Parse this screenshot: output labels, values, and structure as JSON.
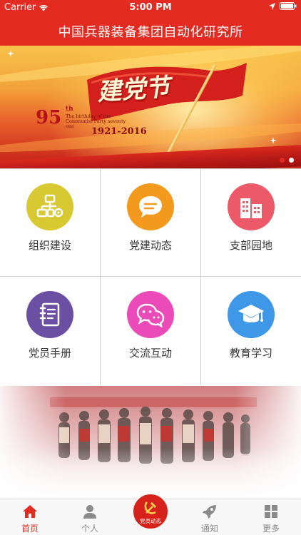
{
  "status_bar": {
    "carrier": "Carrier",
    "time": "5:00 PM"
  },
  "nav": {
    "title": "中国兵器装备集团自动化研究所"
  },
  "banner": {
    "headline": "建党节",
    "anniversary_number": "95",
    "anniversary_suffix": "th",
    "subline": "The birthday of the Communist Party seventy one",
    "years": "1921-2016",
    "active_slide": 1,
    "slide_count": 2
  },
  "grid": {
    "items": [
      {
        "label": "组织建设",
        "icon": "org-structure-icon",
        "color": "#d8c832"
      },
      {
        "label": "党建动态",
        "icon": "chat-bubble-icon",
        "color": "#f39a1e"
      },
      {
        "label": "支部园地",
        "icon": "buildings-icon",
        "color": "#ec5a6a"
      },
      {
        "label": "党员手册",
        "icon": "notebook-icon",
        "color": "#6a4fa3"
      },
      {
        "label": "交流互动",
        "icon": "wechat-bubbles-icon",
        "color": "#ea4bb8"
      },
      {
        "label": "教育学习",
        "icon": "graduation-cap-icon",
        "color": "#3f97e8"
      }
    ]
  },
  "tabbar": {
    "home": "首页",
    "personal": "个人",
    "center": "党员动态",
    "notice": "通知",
    "more": "更多"
  },
  "colors": {
    "brand_red": "#e32b22",
    "tab_inactive": "#8a8a8a"
  }
}
